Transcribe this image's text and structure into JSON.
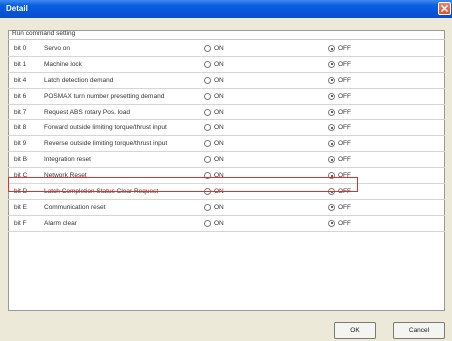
{
  "window": {
    "title": "Detail"
  },
  "group": {
    "label": "Run command setting"
  },
  "options": {
    "on": "ON",
    "off": "OFF"
  },
  "rows": [
    {
      "bit": "bit 0",
      "desc": "Servo on",
      "value": "OFF"
    },
    {
      "bit": "bit 1",
      "desc": "Machine lock",
      "value": "OFF"
    },
    {
      "bit": "bit 4",
      "desc": "Latch detection demand",
      "value": "OFF"
    },
    {
      "bit": "bit 6",
      "desc": "POSMAX turn number presetting demand",
      "value": "OFF"
    },
    {
      "bit": "bit 7",
      "desc": "Request ABS rotary Pos. load",
      "value": "OFF"
    },
    {
      "bit": "bit 8",
      "desc": "Forward outside limiting torque/thrust input",
      "value": "OFF"
    },
    {
      "bit": "bit 9",
      "desc": "Reverse outside limiting torque/thrust input",
      "value": "OFF"
    },
    {
      "bit": "bit B",
      "desc": "Integration reset",
      "value": "OFF"
    },
    {
      "bit": "bit C",
      "desc": "Network Reset",
      "value": "OFF"
    },
    {
      "bit": "bit D",
      "desc": "Latch Completion Status Clear Request",
      "value": "OFF"
    },
    {
      "bit": "bit E",
      "desc": "Communication reset",
      "value": "OFF"
    },
    {
      "bit": "bit F",
      "desc": "Alarm clear",
      "value": "OFF"
    }
  ],
  "highlighted_row": "bit C",
  "buttons": {
    "ok": "OK",
    "cancel": "Cancel"
  },
  "colors": {
    "titlebar": "#0554d8",
    "highlight": "#d9332c",
    "background": "#ece9d8"
  }
}
